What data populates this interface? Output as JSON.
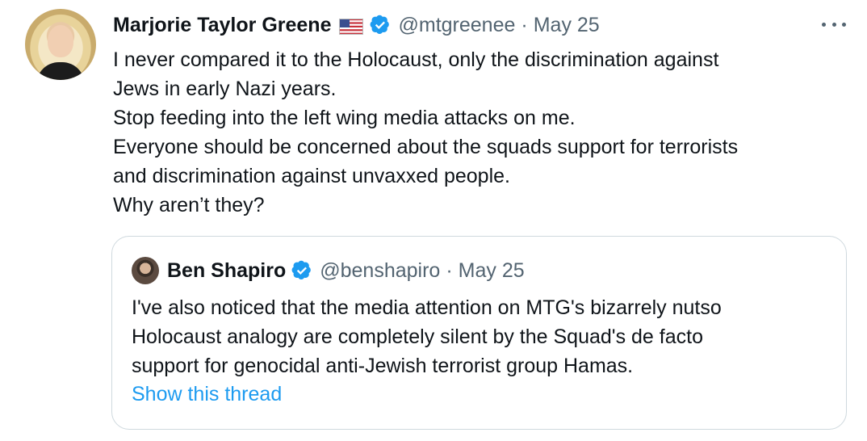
{
  "tweet": {
    "author_name": "Marjorie Taylor Greene",
    "handle": "@mtgreenee",
    "separator": "·",
    "date": "May 25",
    "lines": [
      "I never compared it to the Holocaust, only the discrimination against",
      "Jews in early Nazi years.",
      "Stop feeding into the left wing media attacks on me.",
      "Everyone should be concerned about the squads support for terrorists",
      "and discrimination against unvaxxed people.",
      "Why aren’t they?"
    ]
  },
  "quoted": {
    "author_name": "Ben Shapiro",
    "handle": "@benshapiro",
    "separator": "·",
    "date": "May 25",
    "lines": [
      "I've also noticed that the media attention on MTG's bizarrely nutso",
      "Holocaust analogy are completely silent by the Squad's de facto",
      "support for genocidal anti-Jewish terrorist group Hamas."
    ],
    "show_thread_label": "Show this thread"
  },
  "icons": {
    "flag": "us-flag-icon",
    "verified": "verified-badge-icon",
    "more": "more-options-icon"
  },
  "colors": {
    "text": "#0f1419",
    "muted": "#536471",
    "link": "#1d9bf0",
    "verified": "#1d9bf0",
    "border": "#cfd9de"
  }
}
